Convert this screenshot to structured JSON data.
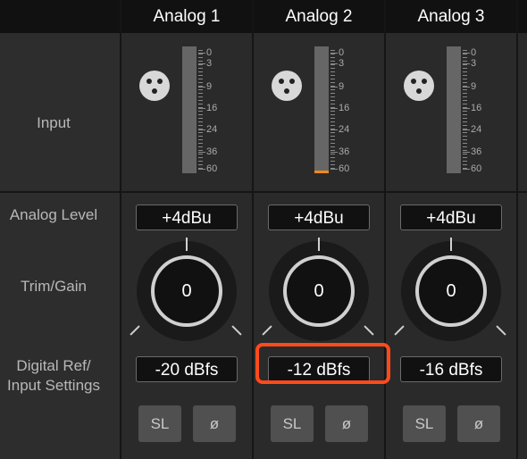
{
  "rows": {
    "input": "Input",
    "analog_level": "Analog Level",
    "trim_gain": "Trim/Gain",
    "digital_ref": "Digital Ref/\nInput Settings"
  },
  "meter_scale": [
    "0",
    "3",
    "9",
    "16",
    "24",
    "36",
    "60"
  ],
  "channels": [
    {
      "name": "Analog 1",
      "analog_level": "+4dBu",
      "trim": "0",
      "digital_ref": "-20 dBfs",
      "sl": "SL",
      "phase": "ø",
      "meter_level": 0.0
    },
    {
      "name": "Analog 2",
      "analog_level": "+4dBu",
      "trim": "0",
      "digital_ref": "-12 dBfs",
      "sl": "SL",
      "phase": "ø",
      "meter_level": 0.02
    },
    {
      "name": "Analog 3",
      "analog_level": "+4dBu",
      "trim": "0",
      "digital_ref": "-16 dBfs",
      "sl": "SL",
      "phase": "ø",
      "meter_level": 0.0
    }
  ],
  "colors": {
    "highlight": "#ff4a1c",
    "meter_fill": "#f08a1c"
  }
}
